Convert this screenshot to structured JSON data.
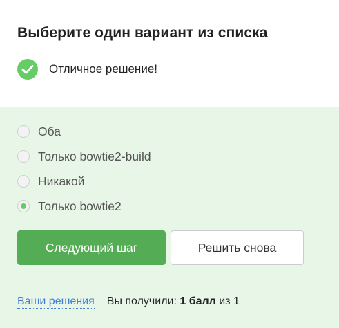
{
  "quiz": {
    "title": "Выберите один вариант из списка",
    "feedback": "Отличное решение!"
  },
  "options": [
    {
      "label": "Оба",
      "selected": false
    },
    {
      "label": "Только bowtie2-build",
      "selected": false
    },
    {
      "label": "Никакой",
      "selected": false
    },
    {
      "label": "Только bowtie2",
      "selected": true
    }
  ],
  "buttons": {
    "next": "Следующий шаг",
    "retry": "Решить снова"
  },
  "footer": {
    "solutions_link": "Ваши решения",
    "score_prefix": "Вы получили:",
    "score_value": "1 балл",
    "score_suffix": "из 1"
  },
  "colors": {
    "success": "#66cc66",
    "answer_bg": "#e7f6e7",
    "primary_button": "#54ad54",
    "link": "#3f7fd6"
  },
  "icons": {
    "feedback": "check-circle-icon"
  }
}
